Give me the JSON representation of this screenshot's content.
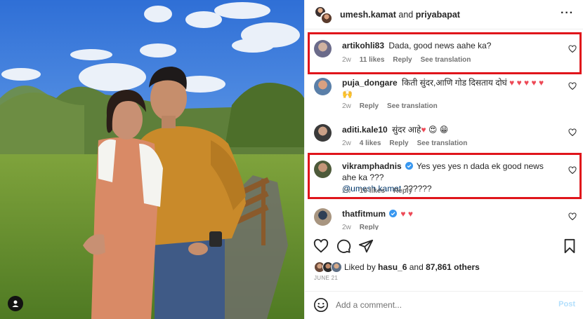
{
  "post": {
    "author_primary": "umesh.kamat",
    "and_label": "and",
    "author_secondary": "priyabapat",
    "more_icon": "more-horizontal-icon"
  },
  "comments": [
    {
      "username": "artikohli83",
      "text": "Dada, good news aahe ka?",
      "time": "2w",
      "likes": "11 likes",
      "reply": "Reply",
      "translation": "See translation",
      "highlighted": true,
      "avatar_color": "#6b6b8a"
    },
    {
      "username": "puja_dongare",
      "text": "किती सुंदर,आणि गोड दिसताय दोघं ♥ ♥ ♥ ♥ ♥",
      "text_line2": "🙌",
      "time": "2w",
      "reply": "Reply",
      "translation": "See translation",
      "highlighted": false,
      "avatar_color": "#5a7fa8"
    },
    {
      "username": "aditi.kale10",
      "text": "सुंदर आहे♥ 😍 😁",
      "time": "2w",
      "likes": "4 likes",
      "reply": "Reply",
      "translation": "See translation",
      "highlighted": false,
      "avatar_color": "#3a3a3a"
    },
    {
      "username": "vikramphadnis",
      "verified": true,
      "text": "Yes yes yes n dada ek good news ahe ka ???",
      "mention": "@umesh.kamat",
      "text_tail": "??????",
      "time": "2w",
      "likes": "19 likes",
      "reply": "Reply",
      "highlighted": true,
      "avatar_color": "#4d5a3a"
    },
    {
      "username": "thatfitmum",
      "verified": true,
      "text": "♥ ♥",
      "time": "2w",
      "reply": "Reply",
      "highlighted": false,
      "avatar_color": "#a89580"
    }
  ],
  "likes": {
    "prefix": "Liked by",
    "user": "hasu_6",
    "middle": "and",
    "count": "87,861 others"
  },
  "date": "JUNE 21",
  "add_comment": {
    "placeholder": "Add a comment...",
    "post_label": "Post"
  },
  "colors": {
    "highlight_border": "#e0151b",
    "heart_red": "#ed4956",
    "verified_blue": "#3897f0",
    "post_button": "#b2dffc"
  },
  "icons": [
    "heart-icon",
    "comment-icon",
    "share-icon",
    "bookmark-icon",
    "emoji-icon",
    "user-tag-icon"
  ]
}
